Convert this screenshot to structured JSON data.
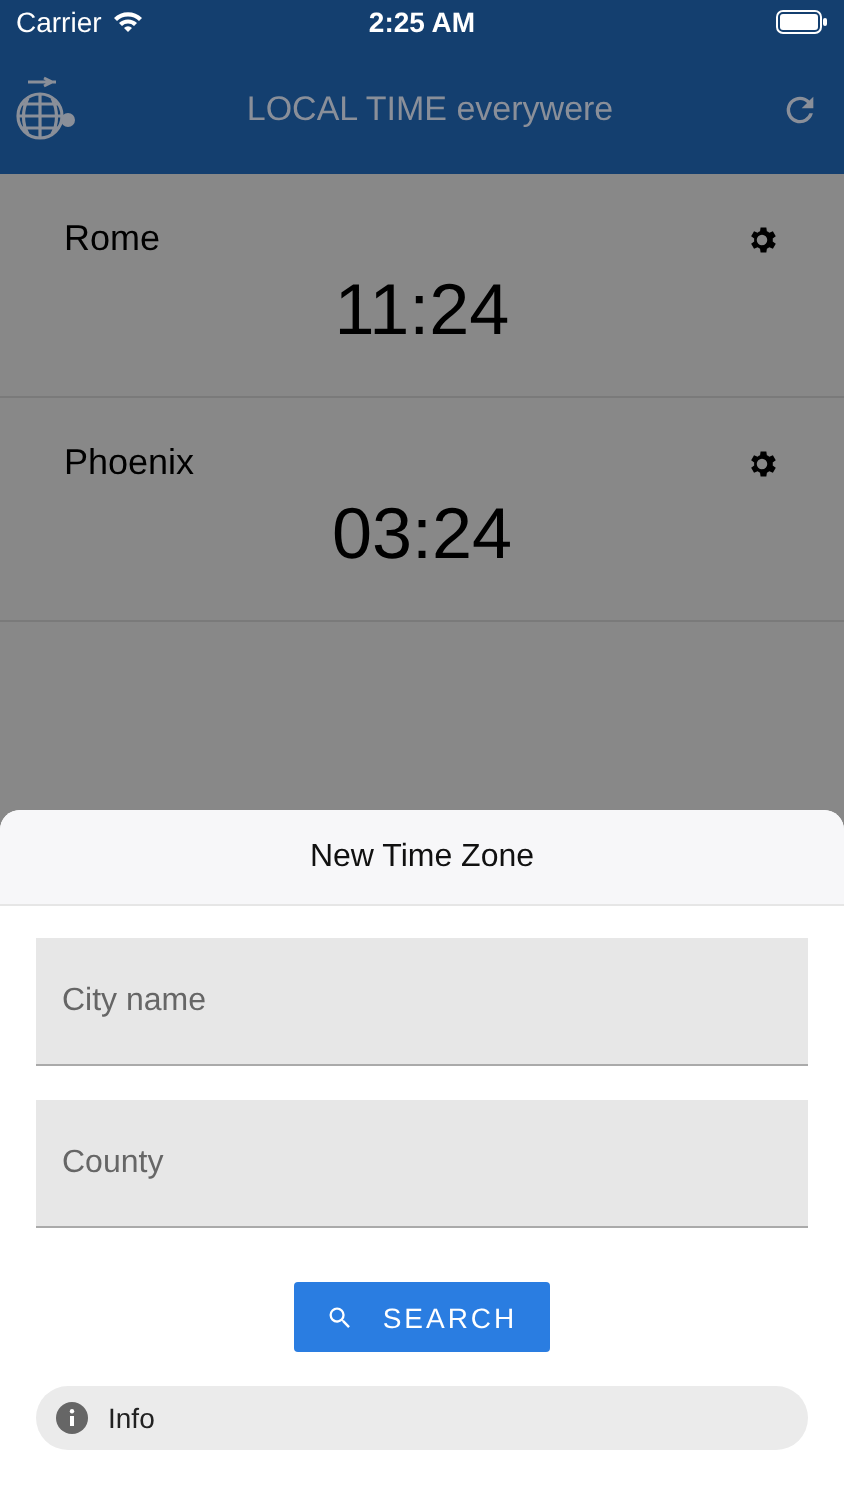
{
  "status_bar": {
    "carrier": "Carrier",
    "time": "2:25 AM"
  },
  "app_bar": {
    "title": "LOCAL TIME everywere"
  },
  "clocks": [
    {
      "city": "Rome",
      "time": "11:24"
    },
    {
      "city": "Phoenix",
      "time": "03:24"
    }
  ],
  "sheet": {
    "title": "New Time Zone",
    "fields": [
      {
        "placeholder": "City name"
      },
      {
        "placeholder": "County"
      }
    ],
    "search_button": "SEARCH",
    "info": "Info"
  }
}
